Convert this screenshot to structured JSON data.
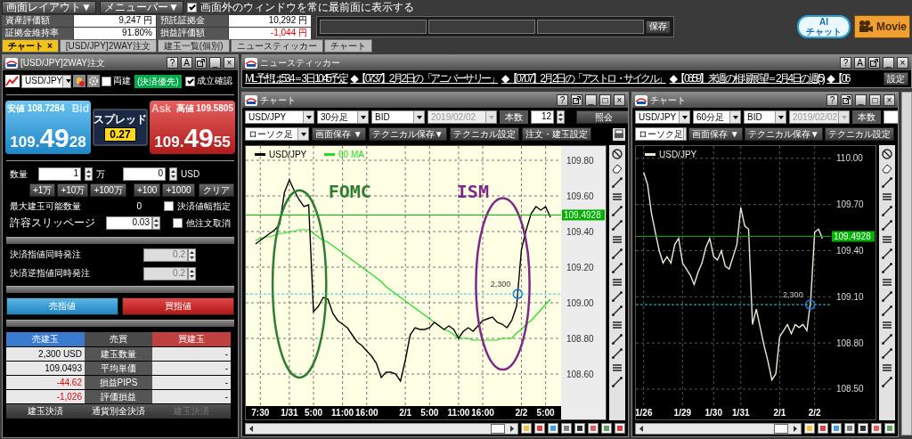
{
  "toolbar": {
    "buttons": [
      {
        "label": "画面レイアウト▼"
      },
      {
        "label": "メニューバー▼"
      }
    ],
    "topmost_option": {
      "label": "画面外のウィンドウを常に最前面に表示する",
      "checked": true
    }
  },
  "account_summary": [
    {
      "label": "資産評価額",
      "value": "9,247 円",
      "negative": false
    },
    {
      "label": "預託証拠金",
      "value": "10,292 円",
      "negative": false
    },
    {
      "label": "証拠金維持率",
      "value": "91.80%",
      "negative": false
    },
    {
      "label": "損益評価額",
      "value": "-1,044 円",
      "negative": true
    }
  ],
  "save_button": "保存",
  "ai_chat_button": {
    "line_1": "AI",
    "line_2": "チャット"
  },
  "movie_button": "Movie",
  "tabs": [
    {
      "label": "チャート",
      "selected": true,
      "close": "×"
    },
    {
      "label": "[USD/JPY]2WAY注文",
      "selected": false
    },
    {
      "label": "建玉一覧(個別)",
      "selected": false
    },
    {
      "label": "ニュースティッカー",
      "selected": false
    },
    {
      "label": "チャート",
      "selected": false
    }
  ],
  "order_window": {
    "title": "[USD/JPY]2WAY注文",
    "title_buttons": [
      {
        "kind": "text",
        "glyph": "?"
      },
      {
        "kind": "text",
        "glyph": "A"
      },
      {
        "kind": "popout"
      },
      {
        "kind": "text",
        "glyph": "_"
      },
      {
        "kind": "text",
        "glyph": "×"
      }
    ],
    "pair": "USD/JPY",
    "hedge": {
      "label": "両建",
      "checked": false
    },
    "mode_badge": "(決済優先)",
    "confirm": {
      "label": "成立確認",
      "checked": true
    },
    "bid": {
      "watermark": "Bid",
      "range_label": "安値",
      "range_value": "108.7284",
      "price_head": "109.",
      "price_big": "49",
      "price_tail": "28"
    },
    "ask": {
      "watermark": "Ask",
      "range_label": "高値",
      "range_value": "109.5805",
      "price_head": "109.",
      "price_big": "49",
      "price_tail": "55"
    },
    "spread": {
      "label": "スプレッド",
      "value": "0.27"
    },
    "quantity": {
      "label": "数量",
      "units_value": "1",
      "units_label": "万",
      "usd_value": "0",
      "usd_label": "USD"
    },
    "unit_increments": [
      "+1万",
      "+10万",
      "+100万"
    ],
    "usd_increments": [
      "+100",
      "+1000"
    ],
    "clear_button": "クリア",
    "max_quantity": {
      "label": "最大建玉可能数量",
      "value": "0"
    },
    "slippage": {
      "label": "許容スリッページ",
      "value": "0.03"
    },
    "options": [
      {
        "label": "決済値幅指定",
        "checked": false
      },
      {
        "label": "他注文取消",
        "checked": false
      }
    ],
    "settlement_orders": [
      {
        "label": "決済指値同時発注",
        "value": "0.2",
        "disabled": true
      },
      {
        "label": "決済逆指値同時発注",
        "value": "0.2",
        "disabled": true
      }
    ],
    "sell_button": "売指値",
    "buy_button": "買指値",
    "positions": {
      "columns": [
        "売建玉",
        "売買",
        "買建玉"
      ],
      "rows": [
        {
          "sell": "2,300 USD",
          "label": "建玉数量",
          "buy": "-",
          "negative": false
        },
        {
          "sell": "109.0493",
          "label": "平均単価",
          "buy": "-",
          "negative": false
        },
        {
          "sell": "-44.62",
          "label": "損益PIPS",
          "buy": "-",
          "negative": true
        },
        {
          "sell": "-1,026",
          "label": "評価損益",
          "buy": "-",
          "negative": true
        }
      ]
    },
    "actions": [
      {
        "label": "建玉決済",
        "disabled": false
      },
      {
        "label": "通貨別全決済",
        "disabled": false
      },
      {
        "label": "建玉決済",
        "disabled": true
      }
    ]
  },
  "news_window": {
    "title": "ニュースティッカー",
    "title_buttons": [
      {
        "kind": "text",
        "glyph": "?"
      },
      {
        "kind": "text",
        "glyph": "A"
      },
      {
        "kind": "popout"
      },
      {
        "kind": "text",
        "glyph": "_"
      },
      {
        "kind": "text",
        "glyph": "×"
      }
    ],
    "items": [
      "ML 予想は53.4＝3日 10:45予定",
      "◆【07:37】2月2日の「アニバーサリー」",
      "◆【07:07】2月2日の「アストロ・サイクル」",
      "◆【06:59】来週の相場展望＝2月4日の週(5)",
      "◆【06"
    ],
    "settings_button": "設定"
  },
  "chart_windows": [
    {
      "kind": "light",
      "title": "チャート",
      "title_buttons": [
        {
          "kind": "text",
          "glyph": "?"
        },
        {
          "kind": "popout"
        },
        {
          "kind": "text",
          "glyph": "_"
        },
        {
          "kind": "text",
          "glyph": "□"
        },
        {
          "kind": "text",
          "glyph": "×"
        }
      ],
      "pair": "USD/JPY",
      "timeframe": "30分足",
      "price_type": "BID",
      "date": "2019/02/02",
      "bars_label": "本数",
      "bars": "12",
      "query_button": "照会",
      "chart_type": "ローソク足",
      "buttons": [
        "画面保存 ▼",
        "テクニカル保存▼",
        "テクニカル設定",
        "注文・建玉設定"
      ],
      "print_button": true,
      "chart_data": {
        "type": "line",
        "categories": [
          null,
          "7:30",
          null,
          null,
          null,
          null,
          null,
          "1/31",
          null,
          null,
          null,
          null,
          "5:00",
          null,
          null,
          null,
          null,
          null,
          "11:00",
          null,
          null,
          null,
          null,
          "16:00",
          null,
          null,
          null,
          null,
          null,
          null,
          null,
          "2/1",
          null,
          null,
          null,
          null,
          "5:00",
          null,
          null,
          null,
          null,
          null,
          "11:00",
          null,
          null,
          null,
          null,
          "16:00",
          null,
          null,
          null,
          null,
          null,
          null,
          null,
          "2/2",
          null,
          null,
          null,
          null,
          "5:00",
          null
        ],
        "series": [
          {
            "name": "USD/JPY",
            "color": "#000000",
            "values": [
              109.33,
              109.35,
              109.37,
              109.39,
              109.41,
              109.44,
              109.62,
              109.69,
              109.63,
              109.58,
              109.54,
              109.55,
              108.95,
              108.98,
              109.03,
              109.02,
              108.94,
              108.9,
              108.88,
              108.86,
              108.82,
              108.78,
              108.76,
              108.73,
              108.7,
              108.66,
              108.58,
              108.61,
              108.61,
              108.6,
              108.56,
              108.68,
              108.82,
              108.86,
              108.85,
              108.85,
              108.86,
              108.89,
              108.87,
              108.85,
              108.87,
              108.85,
              108.8,
              108.84,
              108.86,
              108.84,
              108.87,
              108.9,
              108.91,
              108.92,
              108.89,
              108.88,
              108.86,
              108.9,
              108.98,
              109.3,
              109.41,
              109.5,
              109.54,
              109.52,
              109.54,
              109.48
            ]
          },
          {
            "name": "60 MA",
            "color": "#22dd22",
            "values": [
              109.35,
              109.36,
              109.37,
              109.37,
              109.38,
              109.39,
              109.39,
              109.4,
              109.4,
              109.41,
              109.41,
              109.41,
              109.39,
              109.37,
              109.35,
              109.34,
              109.32,
              109.3,
              109.28,
              109.26,
              109.24,
              109.22,
              109.2,
              109.18,
              109.16,
              109.14,
              109.12,
              109.09,
              109.07,
              109.05,
              109.03,
              109.01,
              108.99,
              108.97,
              108.95,
              108.93,
              108.91,
              108.89,
              108.87,
              108.85,
              108.84,
              108.82,
              108.8,
              108.8,
              108.8,
              108.79,
              108.79,
              108.79,
              108.79,
              108.79,
              108.79,
              108.8,
              108.8,
              108.8,
              108.83,
              108.85,
              108.88,
              108.9,
              108.93,
              108.96,
              108.99,
              109.02
            ]
          }
        ],
        "ylim": [
          108.42,
          109.88
        ],
        "yticks": [
          {
            "value": 108.6,
            "label": "108.60"
          },
          {
            "value": 108.8,
            "label": "108.80"
          },
          {
            "value": 109.0,
            "label": "109.00"
          },
          {
            "value": 109.2,
            "label": "109.20"
          },
          {
            "value": 109.4,
            "label": "109.40"
          },
          {
            "value": 109.6,
            "label": "109.60"
          },
          {
            "value": 109.8,
            "label": "109.80"
          }
        ],
        "grid": true,
        "legend": "upper left",
        "ref_lines": [
          {
            "axis": "y",
            "value": 109.4928,
            "label": "109.4928",
            "color": "#00b000"
          },
          {
            "axis": "y",
            "value": 109.0493,
            "color": "#33cccc"
          }
        ],
        "annotations": [
          "FOMC",
          "ISM",
          {
            "text": "2,300",
            "y": 109.0493
          }
        ]
      }
    },
    {
      "kind": "dark",
      "title": "チャート",
      "title_buttons": [
        {
          "kind": "text",
          "glyph": "?"
        },
        {
          "kind": "popout"
        },
        {
          "kind": "text",
          "glyph": "_"
        },
        {
          "kind": "text",
          "glyph": "□"
        },
        {
          "kind": "text",
          "glyph": "×"
        }
      ],
      "pair": "USD/JPY",
      "timeframe": "60分足",
      "price_type": "BID",
      "date": "2019/02/02",
      "bars_label": "本数",
      "chart_type": "ローソク足",
      "buttons": [
        "画面保存 ▼",
        "テクニカル保存▼",
        "テクニカル設定"
      ],
      "chart_data": {
        "type": "line",
        "categories": [
          "1/26",
          null,
          null,
          null,
          null,
          null,
          null,
          null,
          null,
          null,
          "1/29",
          null,
          null,
          null,
          null,
          null,
          null,
          null,
          "1/30",
          null,
          null,
          null,
          null,
          null,
          null,
          "1/31",
          null,
          null,
          null,
          null,
          null,
          null,
          null,
          null,
          null,
          "2/1",
          null,
          null,
          null,
          null,
          null,
          null,
          null,
          null,
          "2/2",
          null,
          null
        ],
        "series": [
          {
            "name": "USD/JPY",
            "color": "#ecebd6",
            "values": [
              109.91,
              109.83,
              109.64,
              109.52,
              109.4,
              109.32,
              109.36,
              109.32,
              109.44,
              109.48,
              109.32,
              109.28,
              109.24,
              109.18,
              109.26,
              109.32,
              109.42,
              109.48,
              109.36,
              109.34,
              109.4,
              109.3,
              109.28,
              109.36,
              109.44,
              109.68,
              109.56,
              109.54,
              108.92,
              109.02,
              108.9,
              108.78,
              108.68,
              108.56,
              108.6,
              108.84,
              108.88,
              108.92,
              108.86,
              108.92,
              108.9,
              108.92,
              108.88,
              109.08,
              109.52,
              109.54,
              109.48
            ]
          }
        ],
        "ylim": [
          108.39,
          110.08
        ],
        "yticks": [
          {
            "value": 108.5,
            "label": "108.50"
          },
          {
            "value": 108.8,
            "label": "108.80"
          },
          {
            "value": 109.1,
            "label": "109.10"
          },
          {
            "value": 109.4,
            "label": "109.40"
          },
          {
            "value": 109.7,
            "label": "109.70"
          },
          {
            "value": 110.0,
            "label": "110.00"
          }
        ],
        "grid": true,
        "legend": "upper left",
        "ref_lines": [
          {
            "axis": "y",
            "value": 109.4928,
            "label": "109.4928",
            "color": "#00b000"
          },
          {
            "axis": "y",
            "value": 109.0493,
            "color": "#33cccc"
          }
        ],
        "annotations": [
          {
            "text": "2,300",
            "y": 109.0493
          }
        ]
      }
    }
  ]
}
